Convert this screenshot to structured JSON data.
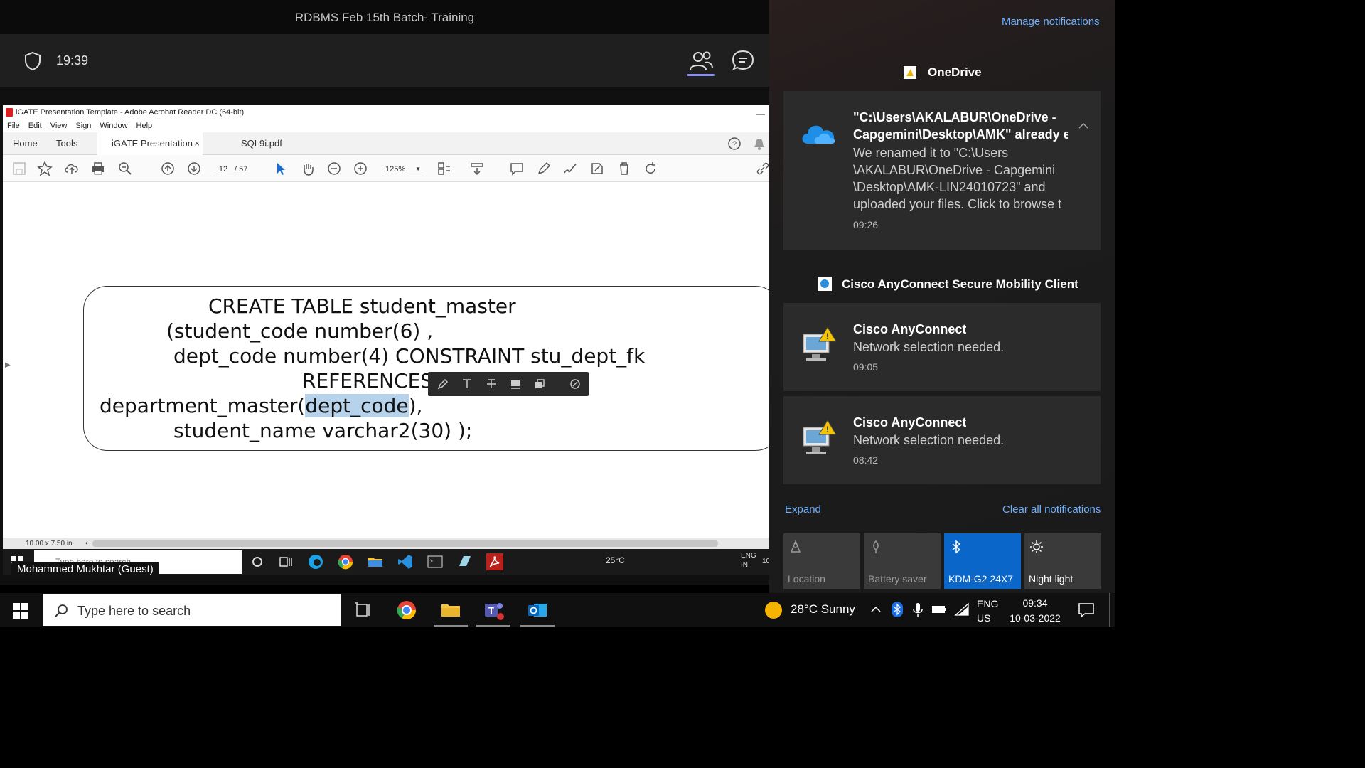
{
  "meeting": {
    "title": "RDBMS Feb 15th Batch- Training",
    "elapsed": "19:39"
  },
  "acrobat": {
    "window_title": "iGATE Presentation Template - Adobe Acrobat Reader DC (64-bit)",
    "menu": [
      "File",
      "Edit",
      "View",
      "Sign",
      "Window",
      "Help"
    ],
    "tabs": {
      "home": "Home",
      "tools": "Tools",
      "doc": "iGATE Presentation ...",
      "close": "×",
      "other": "SQL9i.pdf"
    },
    "page_current": "12",
    "page_total": "/ 57",
    "zoom": "125%",
    "page_size": "10.00 x 7.50 in",
    "sql_lines": [
      "CREATE TABLE student_master",
      "(student_code number(6) ,",
      "dept_code number(4) CONSTRAINT stu_dept_fk",
      "REFERENCES"
    ],
    "sql_line5_prefix": "department_master(",
    "sql_line5_selected": "dept_code",
    "sql_line5_suffix": "),",
    "sql_line6": "student_name varchar2(30) );"
  },
  "shared_taskbar": {
    "search_placeholder": "Type here to search",
    "weather": "25°C",
    "lang": "ENG",
    "region": "IN",
    "clock_partial": "10"
  },
  "guest_label": "Mohammed Mukhtar (Guest)",
  "notifications": {
    "manage": "Manage notifications",
    "onedrive_group": "OneDrive",
    "onedrive": {
      "title_line1": "\"C:\\Users\\AKALABUR\\OneDrive -",
      "title_line2": "Capgemini\\Desktop\\AMK\" already e",
      "body": "We renamed it to \"C:\\Users\n\\AKALABUR\\OneDrive - Capgemini\n\\Desktop\\AMK-LIN24010723\" and\nuploaded your files. Click to browse t",
      "time": "09:26"
    },
    "cisco_group": "Cisco AnyConnect Secure Mobility Client",
    "cisco": [
      {
        "title": "Cisco AnyConnect",
        "body": "Network selection needed.",
        "time": "09:05"
      },
      {
        "title": "Cisco AnyConnect",
        "body": "Network selection needed.",
        "time": "08:42"
      }
    ],
    "expand": "Expand",
    "clear_all": "Clear all notifications",
    "quick_actions": [
      "Location",
      "Battery saver",
      "KDM-G2 24X7",
      "Night light"
    ]
  },
  "taskbar": {
    "search_placeholder": "Type here to search",
    "weather": "28°C  Sunny",
    "lang": "ENG",
    "region": "US",
    "time": "09:34",
    "date": "10-03-2022"
  }
}
